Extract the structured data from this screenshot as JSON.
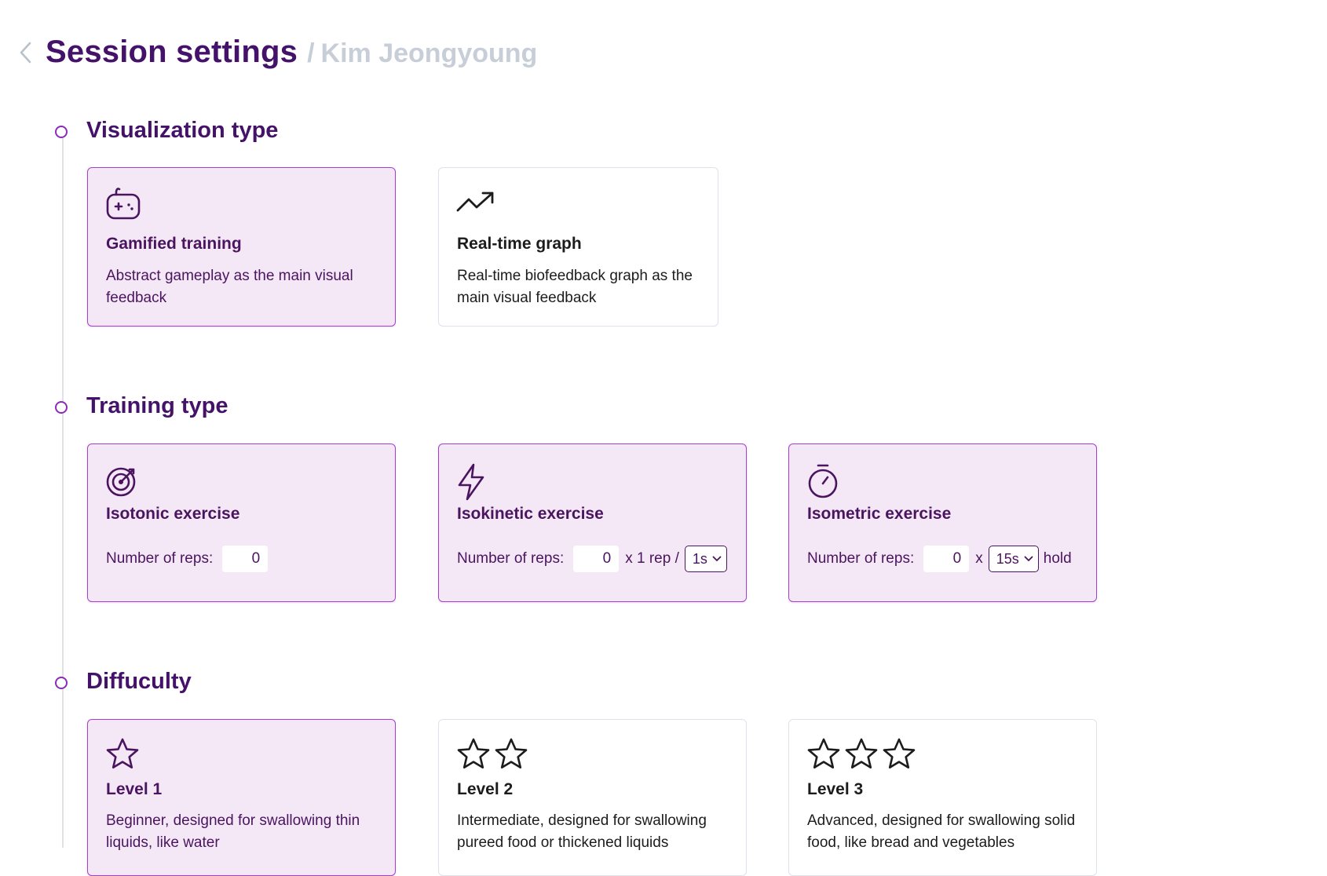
{
  "header": {
    "title": "Session settings",
    "separator": "/",
    "patient_name": "Kim Jeongyoung"
  },
  "sections": {
    "visualization": {
      "title": "Visualization type",
      "cards": [
        {
          "title": "Gamified training",
          "description": "Abstract gameplay as the main visual feedback",
          "icon": "gamepad-icon",
          "selected": true
        },
        {
          "title": "Real-time graph",
          "description": "Real-time biofeedback graph as the main visual feedback",
          "icon": "trending-up-icon",
          "selected": false
        }
      ]
    },
    "training": {
      "title": "Training type",
      "cards": [
        {
          "title": "Isotonic exercise",
          "icon": "target-icon",
          "reps_label": "Number of reps:",
          "reps_value": "0",
          "selected": true
        },
        {
          "title": "Isokinetic exercise",
          "icon": "lightning-icon",
          "reps_label": "Number of reps:",
          "reps_value": "0",
          "mid_text": "x 1 rep /",
          "select_value": "1s",
          "selected": true
        },
        {
          "title": "Isometric exercise",
          "icon": "stopwatch-icon",
          "reps_label": "Number of reps:",
          "reps_value": "0",
          "mid_text": "x",
          "select_value": "15s",
          "end_text": "hold",
          "selected": true
        }
      ]
    },
    "difficulty": {
      "title": "Diffuculty",
      "cards": [
        {
          "title": "Level 1",
          "description": "Beginner, designed for swallowing thin liquids, like water",
          "stars": 1,
          "selected": true
        },
        {
          "title": "Level 2",
          "description": "Intermediate, designed for swallowing pureed food or thickened liquids",
          "stars": 2,
          "selected": false
        },
        {
          "title": "Level 3",
          "description": "Advanced, designed for swallowing solid food, like bread and vegetables",
          "stars": 3,
          "selected": false
        }
      ]
    }
  },
  "colors": {
    "accent": "#45126a",
    "selected_border": "#a63fcd",
    "selected_bg": "#f4e8f7",
    "muted": "#c7ced8"
  }
}
